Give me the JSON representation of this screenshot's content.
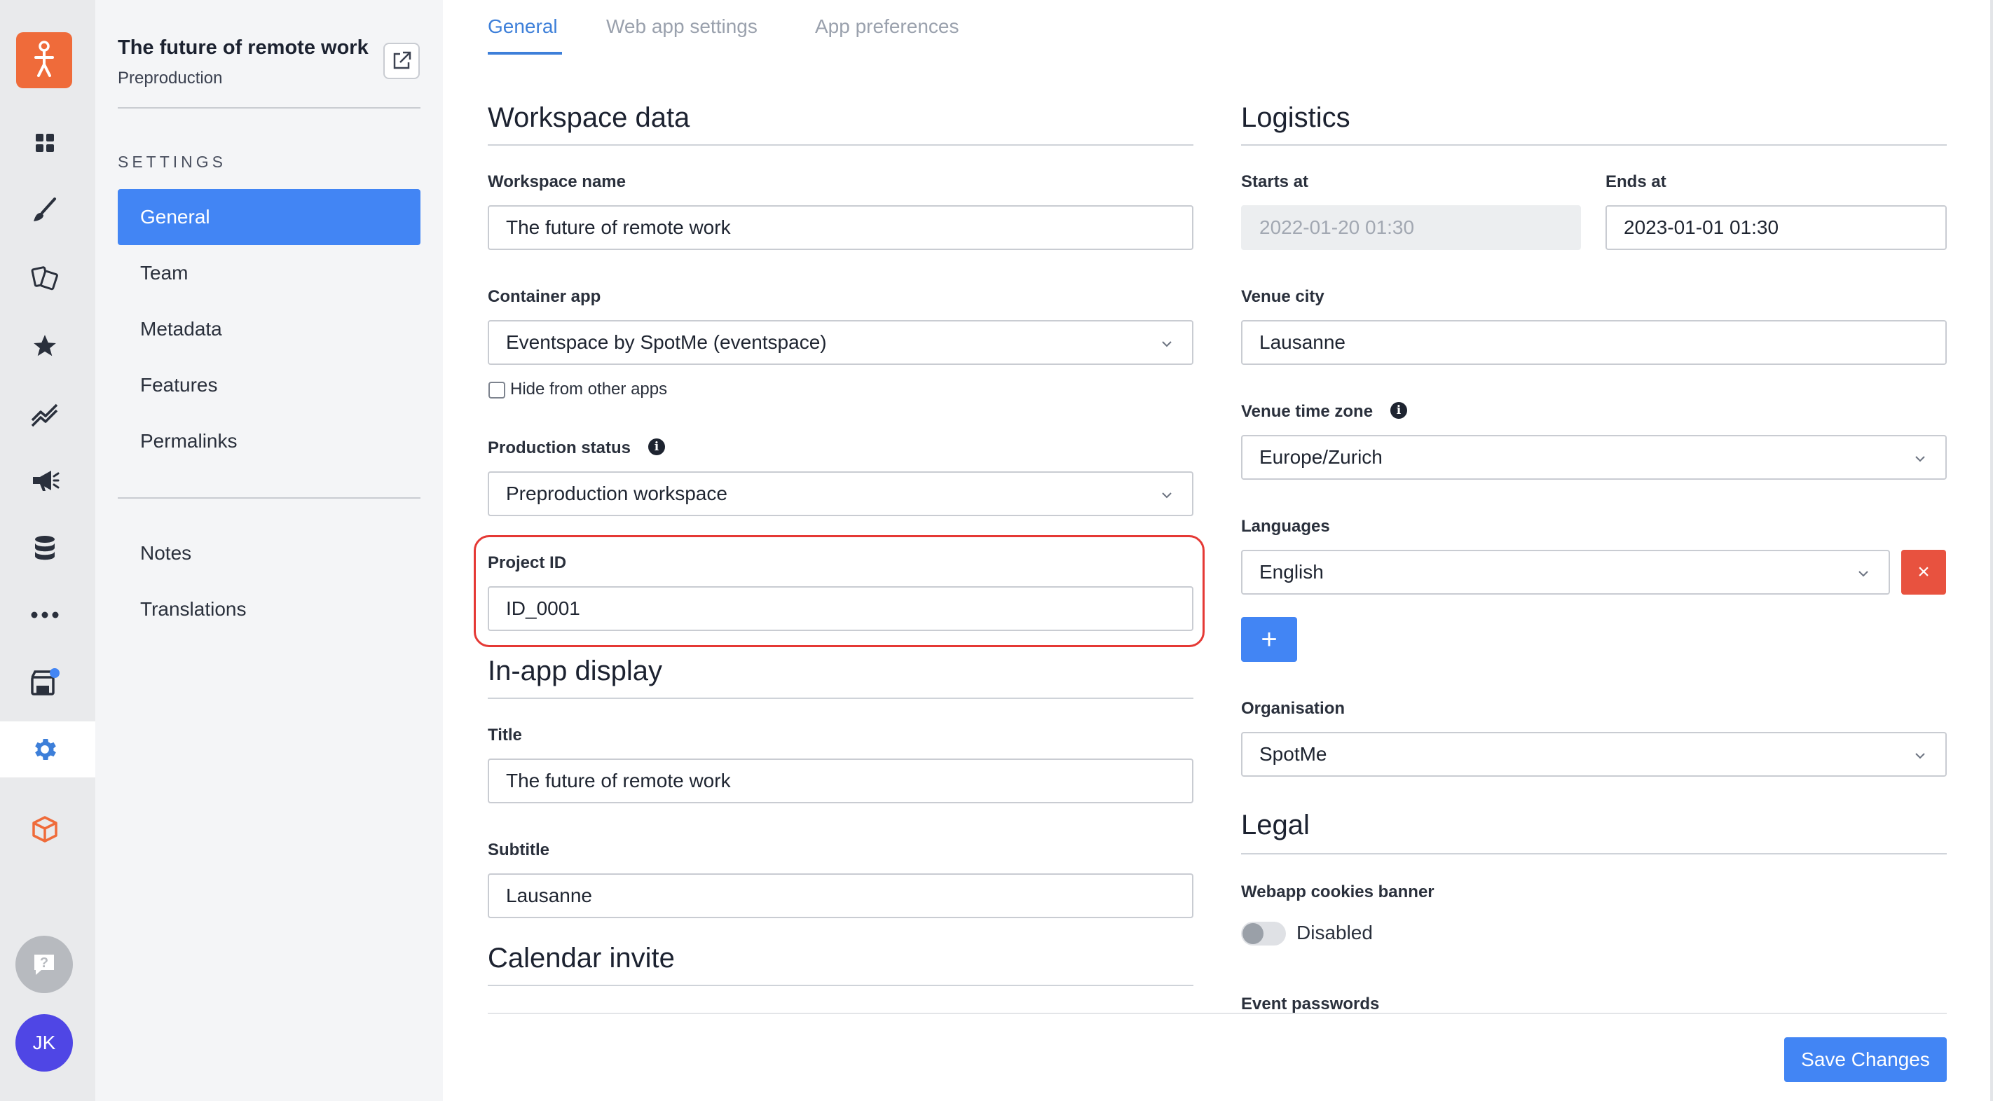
{
  "sidebar": {
    "workspace_title": "The future of remote work",
    "workspace_subtitle": "Preproduction",
    "settings_heading": "SETTINGS",
    "nav_items": [
      {
        "label": "General",
        "active": true
      },
      {
        "label": "Team"
      },
      {
        "label": "Metadata"
      },
      {
        "label": "Features"
      },
      {
        "label": "Permalinks"
      }
    ],
    "extra_items": [
      {
        "label": "Notes"
      },
      {
        "label": "Translations"
      }
    ],
    "rail_icons": [
      "logo-icon",
      "dashboard-icon",
      "brush-icon",
      "documents-icon",
      "star-icon",
      "analytics-icon",
      "megaphone-icon",
      "database-icon",
      "more-icon",
      "store-icon",
      "gear-icon",
      "cube-icon",
      "help-icon"
    ],
    "avatar_initials": "JK"
  },
  "tabs": [
    {
      "label": "General",
      "active": true
    },
    {
      "label": "Web app settings"
    },
    {
      "label": "App preferences"
    }
  ],
  "workspace_data": {
    "title": "Workspace data",
    "workspace_name_label": "Workspace name",
    "workspace_name_value": "The future of remote work",
    "container_app_label": "Container app",
    "container_app_value": "Eventspace by SpotMe (eventspace)",
    "hide_from_other_apps_label": "Hide from other apps",
    "hide_from_other_apps_checked": false,
    "production_status_label": "Production status",
    "production_status_value": "Preproduction workspace",
    "project_id_label": "Project ID",
    "project_id_value": "ID_0001"
  },
  "in_app_display": {
    "title": "In-app display",
    "title_label": "Title",
    "title_value": "The future of remote work",
    "subtitle_label": "Subtitle",
    "subtitle_value": "Lausanne"
  },
  "calendar_invite": {
    "title": "Calendar invite"
  },
  "logistics": {
    "title": "Logistics",
    "starts_at_label": "Starts at",
    "starts_at_value": "2022-01-20 01:30",
    "ends_at_label": "Ends at",
    "ends_at_value": "2023-01-01 01:30",
    "venue_city_label": "Venue city",
    "venue_city_value": "Lausanne",
    "venue_time_zone_label": "Venue time zone",
    "venue_time_zone_value": "Europe/Zurich",
    "languages_label": "Languages",
    "language_value": "English",
    "remove_language_symbol": "×",
    "add_language_symbol": "+",
    "organisation_label": "Organisation",
    "organisation_value": "SpotMe"
  },
  "legal": {
    "title": "Legal",
    "cookies_banner_label": "Webapp cookies banner",
    "cookies_banner_state": "Disabled",
    "event_passwords_label": "Event passwords"
  },
  "footer": {
    "save_label": "Save Changes"
  },
  "colors": {
    "accent": "#4285f4",
    "brand": "#ef6b3a",
    "danger": "#e8523f",
    "highlight": "#e53935"
  }
}
